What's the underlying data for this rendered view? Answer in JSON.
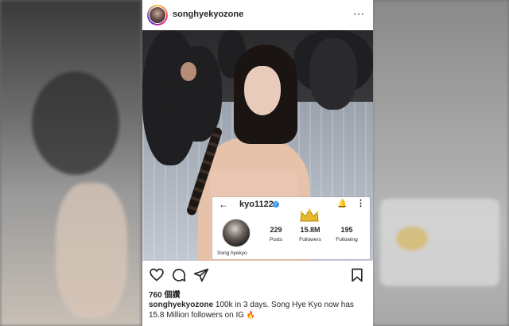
{
  "post": {
    "username": "songhyekyozone",
    "likes_text": "760 個讚",
    "caption_username": "songhyekyozone",
    "caption_text": "100k in 3 days. Song Hye Kyo now has 15.8 Million followers on IG",
    "caption_emoji": "🔥",
    "more_icon": "⋯"
  },
  "profile_screenshot": {
    "username": "kyo1122",
    "display_name": "Song hyekyo",
    "back_icon": "←",
    "bell_icon": "🔔",
    "kebab_icon": "⋮",
    "verified_icon": "✓",
    "stats": {
      "posts_value": "229",
      "posts_label": "Posts",
      "followers_value": "15.8M",
      "followers_label": "Followers",
      "following_value": "195",
      "following_label": "Following"
    }
  },
  "icons": [
    "more-icon",
    "back-icon",
    "verified-icon",
    "bell-icon",
    "kebab-icon",
    "crown-icon",
    "like-icon",
    "comment-icon",
    "share-icon",
    "save-icon"
  ],
  "colors": {
    "text": "#262626",
    "verified": "#3897f0",
    "crown": "#e8b92c"
  }
}
